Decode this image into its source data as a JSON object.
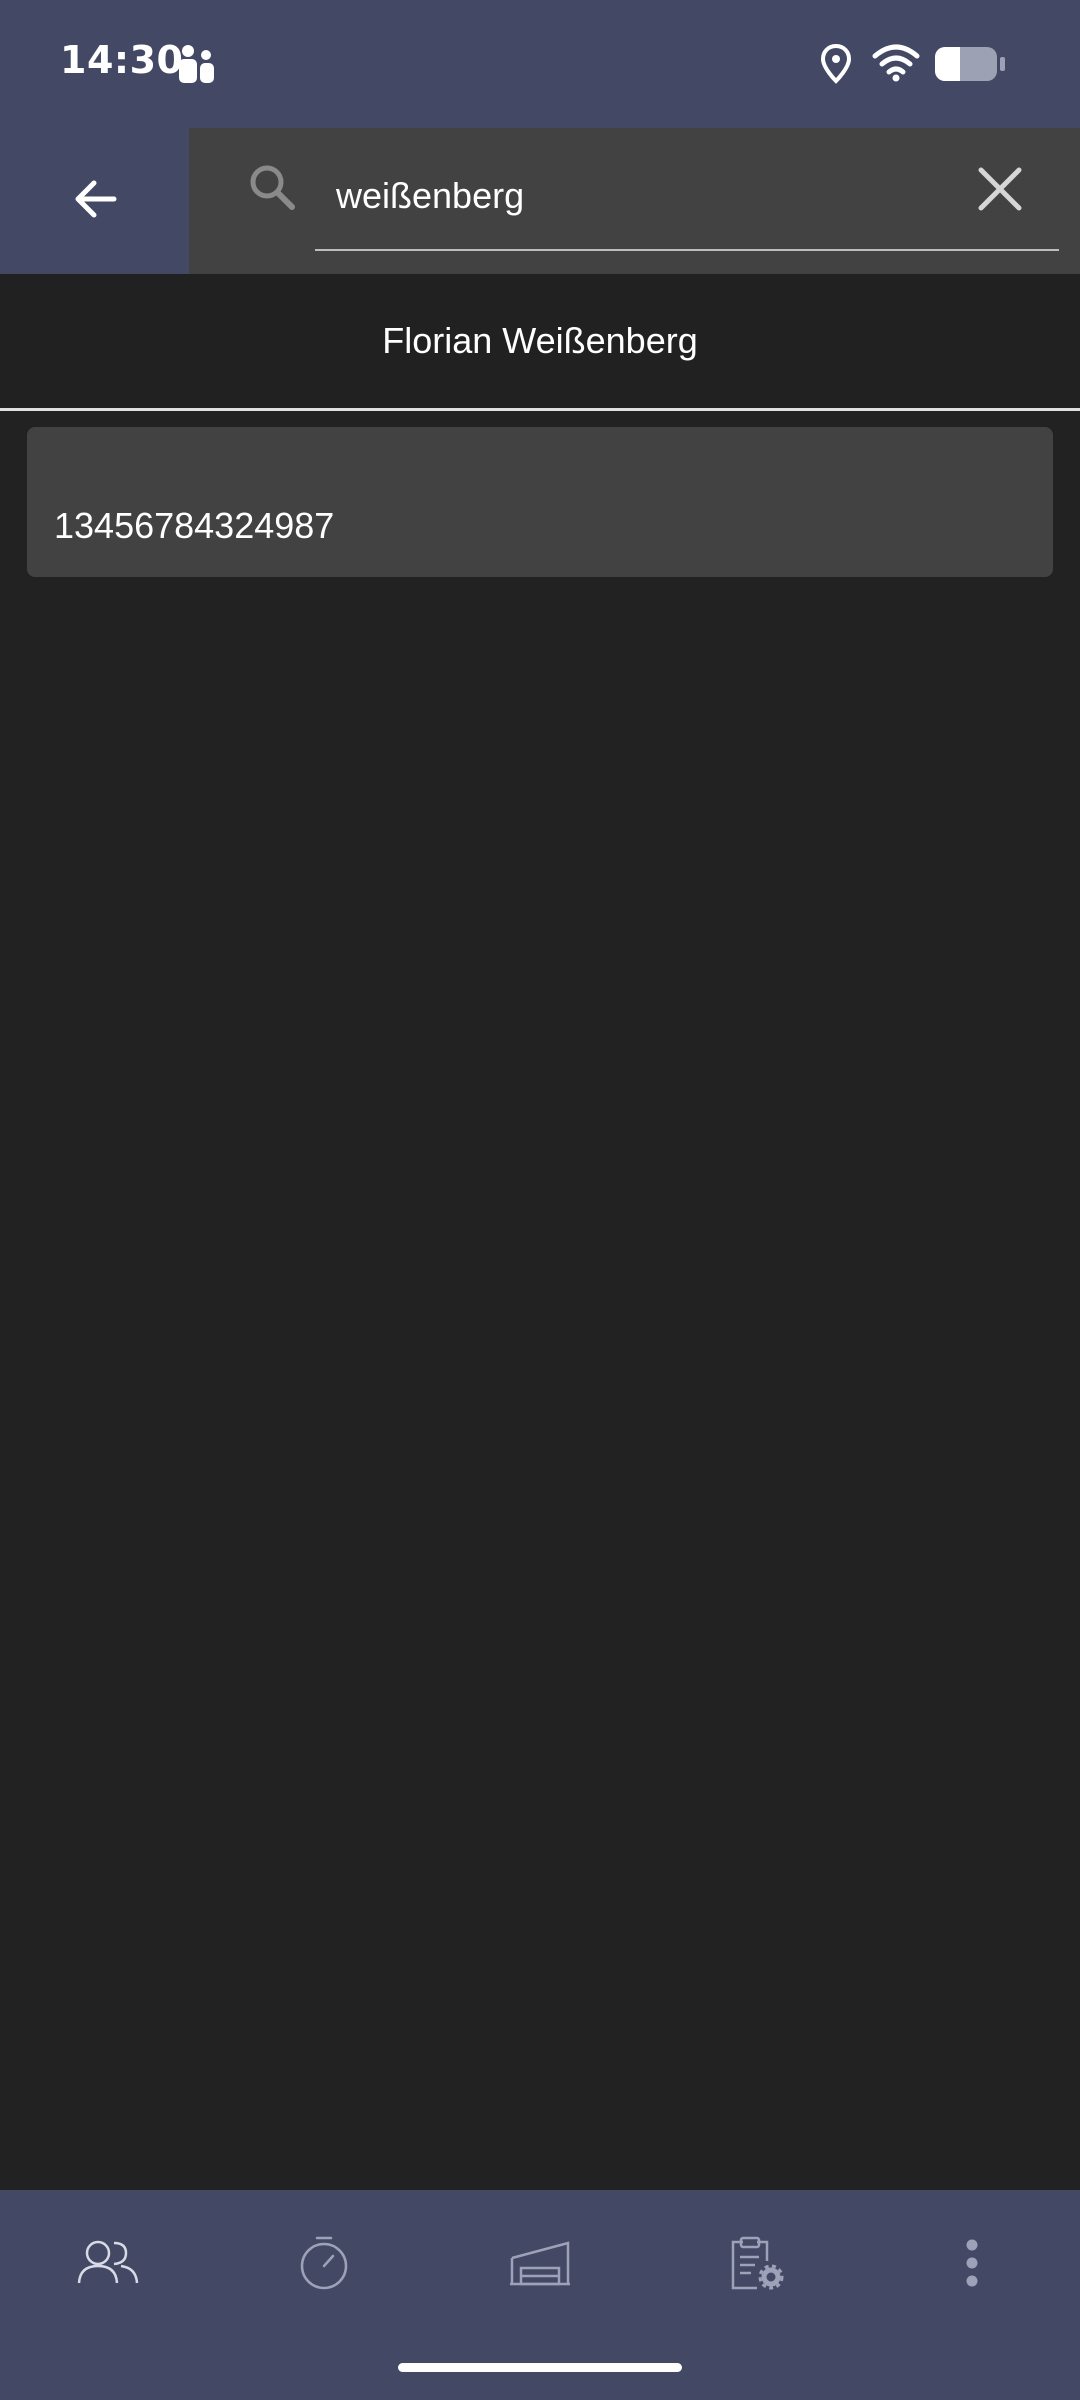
{
  "status_bar": {
    "time": "14:30",
    "icons": [
      "teams-icon",
      "location-icon",
      "wifi-icon",
      "battery-icon"
    ]
  },
  "search": {
    "value": "weißenberg",
    "back_icon": "arrow-left-icon",
    "search_icon": "search-icon",
    "clear_icon": "close-icon"
  },
  "contact": {
    "name": "Florian Weißenberg"
  },
  "results": [
    {
      "number": "13456784324987"
    }
  ],
  "bottom_nav": {
    "items": [
      "contacts-icon",
      "timer-icon",
      "garage-icon",
      "clipboard-settings-icon",
      "more-vert-icon"
    ]
  },
  "colors": {
    "bar_background": "#434964",
    "page_background": "#222222",
    "search_background": "#424242",
    "card_background": "#424242"
  }
}
